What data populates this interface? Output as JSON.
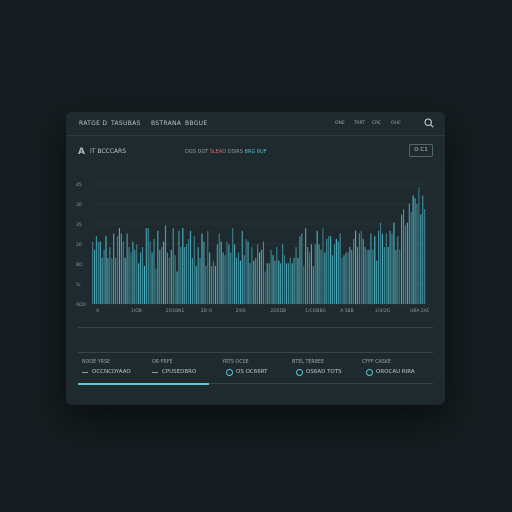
{
  "topbar": {
    "nav": [
      "RATGE D",
      "TASUBAS",
      "BSTRANA",
      "BBGUE"
    ],
    "right": [
      "ONE",
      "TART",
      "CRC",
      "OHC"
    ]
  },
  "header": {
    "logo": "A",
    "title": "IT BCCCARS",
    "legend": [
      "DGS DGT",
      "SLEAD",
      "OSIRS",
      "BRG 6UF"
    ],
    "range_button": "O C1"
  },
  "chart_data": {
    "type": "bar",
    "y_tick_labels": [
      "ADO",
      "5/",
      "BO",
      "20",
      "35",
      "30",
      "45"
    ],
    "x_tick_labels": [
      "A",
      "1/OB",
      "2O1BN1",
      "2D O",
      "2/00",
      "2D5DB",
      "1/COBBG",
      "A 5BB",
      "2/4/2G",
      "UBA 2AO"
    ],
    "colors": {
      "primary": "#4fb8c9",
      "accent": "#d96c6c"
    },
    "values": [
      23,
      20,
      25,
      23,
      23,
      17,
      20,
      25,
      17,
      21,
      17,
      26,
      17,
      25,
      28,
      26,
      23,
      17,
      26,
      21,
      19,
      23,
      20,
      22,
      15,
      19,
      21,
      14,
      28,
      28,
      23,
      19,
      24,
      13,
      27,
      20,
      21,
      23,
      29,
      19,
      17,
      20,
      28,
      18,
      12,
      27,
      21,
      28,
      21,
      22,
      24,
      27,
      17,
      25,
      14,
      21,
      17,
      26,
      23,
      14,
      27,
      19,
      14,
      16,
      14,
      22,
      26,
      23,
      19,
      18,
      23,
      22,
      19,
      28,
      22,
      17,
      19,
      16,
      27,
      18,
      24,
      23,
      15,
      21,
      16,
      17,
      22,
      19,
      20,
      23,
      12,
      15,
      15,
      20,
      18,
      16,
      21,
      16,
      15,
      22,
      18,
      15,
      15,
      17,
      15,
      17,
      21,
      17,
      25,
      26,
      14,
      28,
      21,
      19,
      22,
      14,
      22,
      27,
      22,
      20,
      28,
      19,
      24,
      25,
      25,
      18,
      22,
      24,
      23,
      26,
      17,
      18,
      19,
      19,
      21,
      20,
      24,
      27,
      21,
      26,
      27,
      24,
      21,
      20,
      20,
      26,
      20,
      25,
      16,
      27,
      30,
      26,
      21,
      26,
      21,
      27,
      26,
      30,
      20,
      25,
      20,
      33,
      35,
      29,
      30,
      37,
      34,
      40,
      39,
      37,
      43,
      33,
      40,
      35
    ],
    "ylim": [
      0,
      45
    ]
  },
  "stats": [
    {
      "label": "NOOE YRSE",
      "value": "OCCNCDYAAO"
    },
    {
      "label": "OR FRFE",
      "value": "CPUSEDBRO"
    },
    {
      "label": "YRTS OCSE",
      "value": "OS OC66RT"
    },
    {
      "label": "BTEL TERBEE",
      "value": "OS6AD TOTS"
    },
    {
      "label": "CFFF CASKE",
      "value": "OROCAU RIRA"
    }
  ],
  "progress": {
    "fraction": 0.37
  }
}
